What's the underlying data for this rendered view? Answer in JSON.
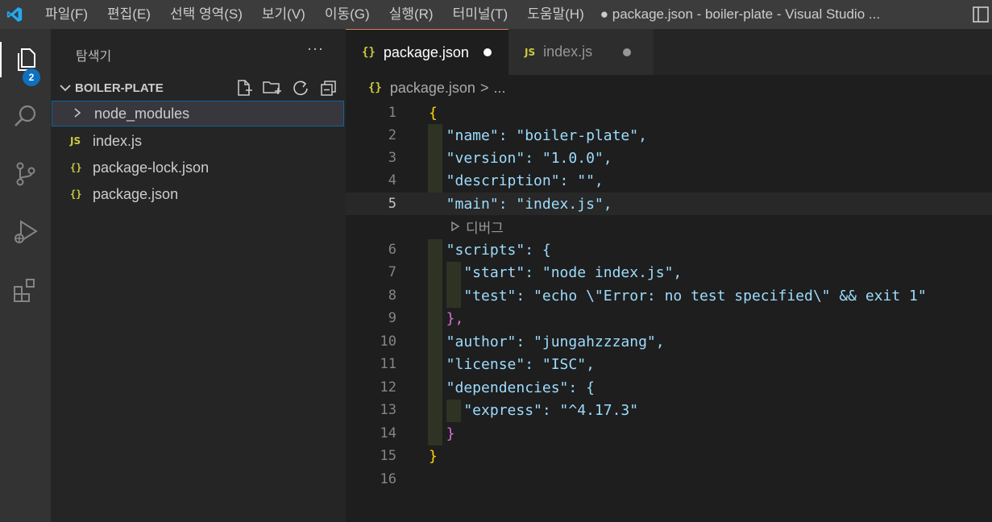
{
  "menu": [
    "파일(F)",
    "편집(E)",
    "선택 영역(S)",
    "보기(V)",
    "이동(G)",
    "실행(R)",
    "터미널(T)",
    "도움말(H)"
  ],
  "window_title": "● package.json - boiler-plate - Visual Studio ...",
  "activity": {
    "explorer_badge": "2"
  },
  "sidebar": {
    "title": "탐색기",
    "more": "···",
    "section_title": "BOILER-PLATE",
    "tree": [
      {
        "label": "node_modules",
        "kind": "folder",
        "icon": "chevron-right-icon"
      },
      {
        "label": "index.js",
        "kind": "js",
        "icon_text": "JS"
      },
      {
        "label": "package-lock.json",
        "kind": "json",
        "icon_text": "{}"
      },
      {
        "label": "package.json",
        "kind": "json",
        "icon_text": "{}"
      }
    ]
  },
  "tabs": [
    {
      "label": "package.json",
      "icon_text": "{}",
      "active": true,
      "modified": true
    },
    {
      "label": "index.js",
      "icon_text": "JS",
      "active": false,
      "modified": true
    }
  ],
  "breadcrumb": {
    "icon_text": "{}",
    "file": "package.json",
    "sep": ">",
    "more": "..."
  },
  "editor": {
    "current_line": "5",
    "codelens": "디버그",
    "lines": [
      {
        "n": "1",
        "text": "{"
      },
      {
        "n": "2",
        "text": "  \"name\": \"boiler-plate\","
      },
      {
        "n": "3",
        "text": "  \"version\": \"1.0.0\","
      },
      {
        "n": "4",
        "text": "  \"description\": \"\","
      },
      {
        "n": "5",
        "text": "  \"main\": \"index.js\","
      },
      {
        "n": "6",
        "text": "  \"scripts\": {"
      },
      {
        "n": "7",
        "text": "    \"start\": \"node index.js\","
      },
      {
        "n": "8",
        "text": "    \"test\": \"echo \\\"Error: no test specified\\\" && exit 1\""
      },
      {
        "n": "9",
        "text": "  },"
      },
      {
        "n": "10",
        "text": "  \"author\": \"jungahzzzang\","
      },
      {
        "n": "11",
        "text": "  \"license\": \"ISC\","
      },
      {
        "n": "12",
        "text": "  \"dependencies\": {"
      },
      {
        "n": "13",
        "text": "    \"express\": \"^4.17.3\""
      },
      {
        "n": "14",
        "text": "  }"
      },
      {
        "n": "15",
        "text": "}"
      },
      {
        "n": "16",
        "text": ""
      }
    ]
  },
  "colors": {
    "accent": "#0e70c0",
    "json_icon": "#cbcb41",
    "modified_dot": "#cccccc"
  }
}
